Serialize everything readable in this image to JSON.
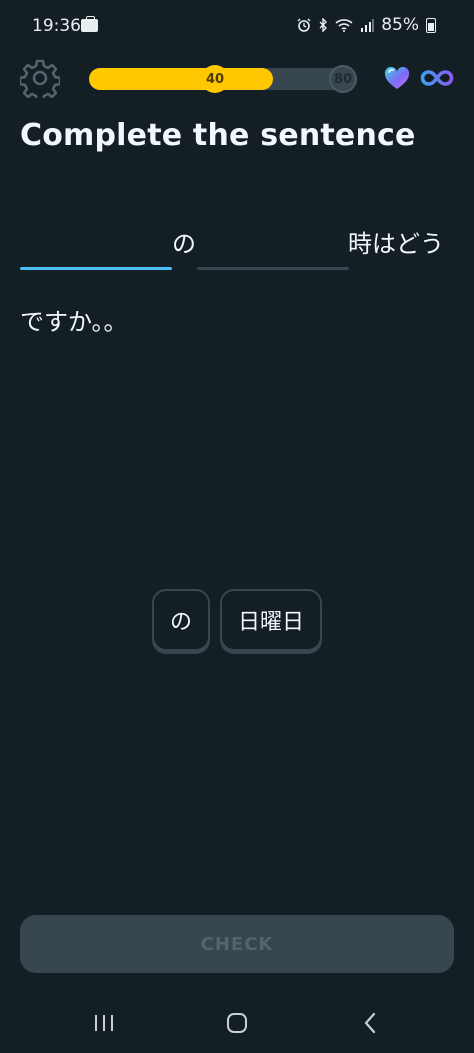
{
  "status_bar": {
    "time": "19:36",
    "battery": "85%"
  },
  "header": {
    "progress": {
      "current": 40,
      "max": 80,
      "current_label": "40",
      "max_label": "80"
    },
    "icons": [
      "gear-icon",
      "heart-icon",
      "infinity-icon"
    ]
  },
  "lesson": {
    "title": "Complete the sentence",
    "sentence_parts": [
      "の",
      "時はどう",
      "ですか。。"
    ],
    "word_bank": [
      "の",
      "日曜日"
    ],
    "check_label": "CHECK"
  },
  "colors": {
    "background": "#131f24",
    "progress_fill": "#ffc800",
    "active_blank": "#49c0f8",
    "inactive": "#37464f"
  }
}
